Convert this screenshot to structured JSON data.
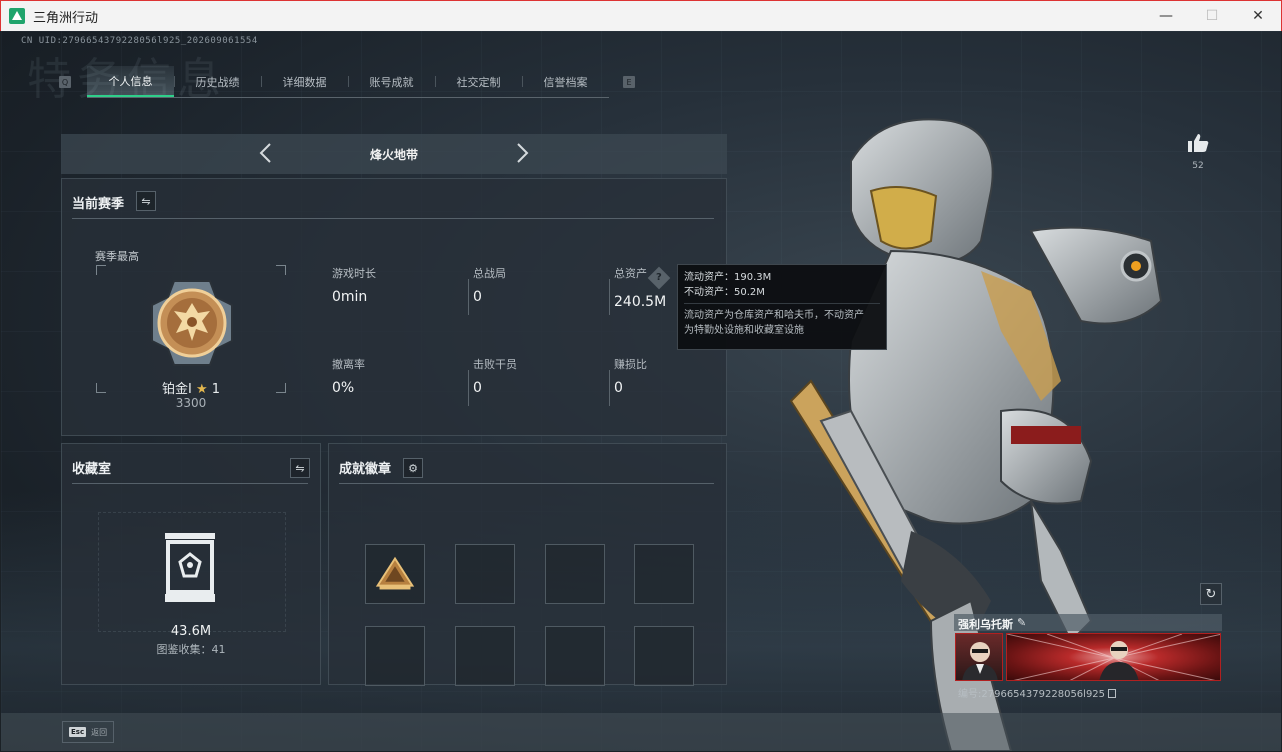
{
  "window": {
    "title": "三角洲行动",
    "minimize": "—",
    "maximize": "☐",
    "close": "✕"
  },
  "uid_line": "CN UID:2796654379228056l925_202609061554",
  "bg_title": "特务信息",
  "tabs": {
    "left_key": "Q",
    "right_key": "E",
    "items": [
      {
        "label": "个人信息",
        "active": true
      },
      {
        "label": "历史战绩",
        "active": false
      },
      {
        "label": "详细数据",
        "active": false
      },
      {
        "label": "账号成就",
        "active": false
      },
      {
        "label": "社交定制",
        "active": false
      },
      {
        "label": "信誉档案",
        "active": false
      }
    ]
  },
  "mode": {
    "name": "烽火地带"
  },
  "season": {
    "title": "当前赛季",
    "best_label": "赛季最高",
    "rank_name": "铂金Ⅰ",
    "rank_level": "1",
    "rank_score": "3300",
    "stats": [
      {
        "label": "游戏时长",
        "value": "0min"
      },
      {
        "label": "总战局",
        "value": "0"
      },
      {
        "label": "总资产",
        "value": "240.5M"
      },
      {
        "label": "撤离率",
        "value": "0%"
      },
      {
        "label": "击败干员",
        "value": "0"
      },
      {
        "label": "赚损比",
        "value": "0"
      }
    ],
    "help_icon": "?"
  },
  "tooltip": {
    "liquid": "流动资产：190.3M",
    "fixed": "不动资产：50.2M",
    "desc1": "流动资产为仓库资产和哈夫币，不动资产",
    "desc2": "为特勤处设施和收藏室设施"
  },
  "collection": {
    "title": "收藏室",
    "value": "43.6M",
    "sub": "图鉴收集：41"
  },
  "achievements": {
    "title": "成就徽章"
  },
  "like": {
    "count": "52"
  },
  "player": {
    "name": "强利乌托斯",
    "id": "编号:2796654379228056l925"
  },
  "bottom": {
    "esc_key": "Esc",
    "esc_label": "返回"
  },
  "colors": {
    "accent": "#2ecf8a",
    "panel": "#283038",
    "banner_red": "#b82a2a",
    "gold": "#e2b64e"
  }
}
